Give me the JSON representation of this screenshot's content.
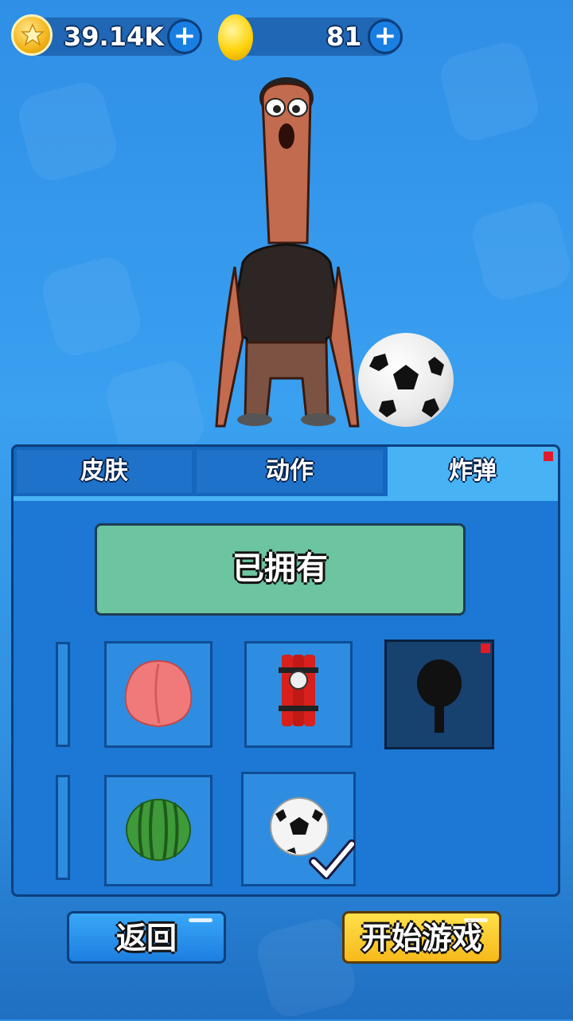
{
  "currency": {
    "stars": "39.14K",
    "gold": "81",
    "add_symbol": "+"
  },
  "tabs": [
    {
      "label": "皮肤",
      "active": false
    },
    {
      "label": "动作",
      "active": false
    },
    {
      "label": "炸弹",
      "active": true,
      "badge": true
    }
  ],
  "status": {
    "owned_label": "已拥有"
  },
  "items": [
    {
      "icon": "peach-icon",
      "selected": false
    },
    {
      "icon": "dynamite-icon",
      "selected": false
    },
    {
      "icon": "frying-pan-icon",
      "selected": true,
      "badge": true
    },
    {
      "icon": "watermelon-icon",
      "selected": false
    },
    {
      "icon": "soccer-ball-icon",
      "equipped": true
    }
  ],
  "buttons": {
    "back": "返回",
    "start": "开始游戏"
  },
  "colors": {
    "accent": "#47b3f5",
    "badge": "#e21b2b",
    "owned_bg": "#6dc4a0",
    "start_btn": "#f7b91a"
  }
}
